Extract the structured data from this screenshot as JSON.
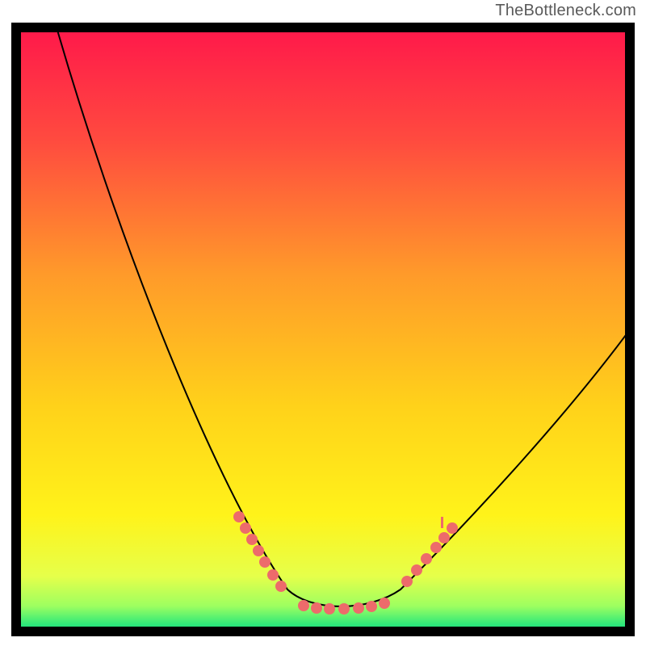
{
  "attribution": "TheBottleneck.com",
  "chart_data": {
    "type": "line",
    "title": "",
    "xlabel": "",
    "ylabel": "",
    "xlim": [
      0,
      100
    ],
    "ylim": [
      0,
      100
    ],
    "grid": false,
    "legend": false,
    "background": "vertical gradient red→orange→yellow→green (red=high bottleneck, green=low)",
    "series": [
      {
        "name": "bottleneck-curve",
        "x": [
          5,
          12,
          20,
          28,
          36,
          44,
          50,
          56,
          62,
          70,
          80,
          90,
          100
        ],
        "y": [
          100,
          78,
          58,
          40,
          24,
          10,
          3,
          3,
          10,
          22,
          36,
          48,
          55
        ],
        "note": "approximate shape of V-curve; y is mismatch/bottleneck %, x is relative component strength"
      }
    ],
    "markers": [
      {
        "name": "left-cluster",
        "approx_points": [
          {
            "x": 36,
            "y": 20
          },
          {
            "x": 37,
            "y": 18
          },
          {
            "x": 38,
            "y": 16
          },
          {
            "x": 39,
            "y": 14
          },
          {
            "x": 40,
            "y": 12
          },
          {
            "x": 42,
            "y": 9
          },
          {
            "x": 43,
            "y": 7
          }
        ],
        "color": "#ed6b6b"
      },
      {
        "name": "bottom-cluster",
        "approx_points": [
          {
            "x": 47,
            "y": 3
          },
          {
            "x": 49,
            "y": 3
          },
          {
            "x": 51,
            "y": 3
          },
          {
            "x": 53,
            "y": 3
          },
          {
            "x": 56,
            "y": 3
          },
          {
            "x": 58,
            "y": 3
          },
          {
            "x": 60,
            "y": 4
          }
        ],
        "color": "#ed6b6b"
      },
      {
        "name": "right-cluster",
        "approx_points": [
          {
            "x": 64,
            "y": 8
          },
          {
            "x": 65,
            "y": 10
          },
          {
            "x": 67,
            "y": 12
          },
          {
            "x": 69,
            "y": 14
          },
          {
            "x": 70,
            "y": 15
          },
          {
            "x": 71,
            "y": 17
          }
        ],
        "color": "#ed6b6b"
      }
    ]
  }
}
